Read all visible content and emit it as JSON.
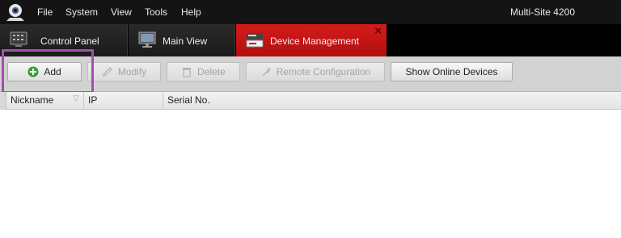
{
  "menu": {
    "items": [
      "File",
      "System",
      "View",
      "Tools",
      "Help"
    ],
    "product_name": "Multi-Site 4200",
    "logo_icon": "webcam-logo-icon"
  },
  "tabs": [
    {
      "label": "Control Panel",
      "icon": "control-panel-icon",
      "active": false
    },
    {
      "label": "Main View",
      "icon": "monitor-icon",
      "active": false
    },
    {
      "label": "Device Management",
      "icon": "device-management-icon",
      "active": true,
      "close": "×"
    }
  ],
  "toolbar": {
    "add_label": "Add",
    "modify_label": "Modify",
    "delete_label": "Delete",
    "remote_config_label": "Remote Configuration",
    "show_online_label": "Show Online Devices"
  },
  "table": {
    "columns": [
      "Nickname",
      "IP",
      "Serial No."
    ],
    "sort_indicator": "▽",
    "rows": []
  },
  "colors": {
    "active_tab": "#c8161a",
    "highlight": "#a44eb0",
    "add_icon": "#3a9b3a"
  }
}
